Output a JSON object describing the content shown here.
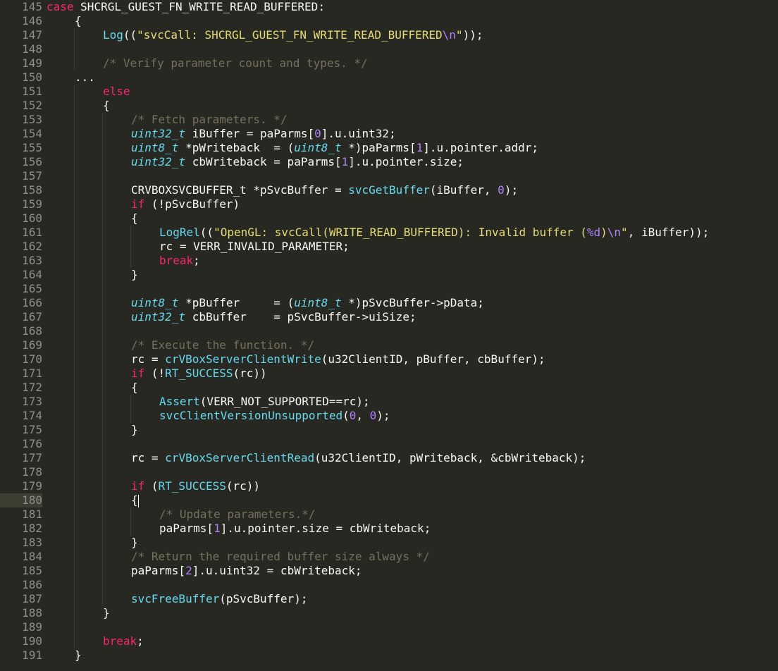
{
  "editor": {
    "theme_colors": {
      "background": "#272822",
      "gutter_text": "#8f908a",
      "keyword": "#f92672",
      "function": "#66d9ef",
      "type": "#66d9ef",
      "number": "#ae81ff",
      "string": "#e6db74",
      "comment": "#75715e",
      "plain": "#f8f8f2",
      "current_line": "#3e3d32"
    },
    "current_line_number": "180",
    "lines": [
      {
        "n": "145",
        "indent": 0,
        "tokens": [
          {
            "t": "kw",
            "v": "case"
          },
          {
            "t": "pl",
            "v": " SHCRGL_GUEST_FN_WRITE_READ_BUFFERED:"
          }
        ]
      },
      {
        "n": "146",
        "indent": 2,
        "tokens": [
          {
            "t": "pl",
            "v": "{"
          }
        ]
      },
      {
        "n": "147",
        "indent": 3,
        "tokens": [
          {
            "t": "fn",
            "v": "Log"
          },
          {
            "t": "pl",
            "v": "(("
          },
          {
            "t": "str",
            "v": "\"svcCall: SHCRGL_GUEST_FN_WRITE_READ_BUFFERED"
          },
          {
            "t": "num",
            "v": "\\n"
          },
          {
            "t": "str",
            "v": "\""
          },
          {
            "t": "pl",
            "v": "));"
          }
        ]
      },
      {
        "n": "148",
        "indent": 3,
        "tokens": []
      },
      {
        "n": "149",
        "indent": 3,
        "tokens": [
          {
            "t": "cmt",
            "v": "/* Verify parameter count and types. */"
          }
        ]
      },
      {
        "n": "150",
        "indent": 2,
        "tokens": [
          {
            "t": "pl",
            "v": "..."
          }
        ]
      },
      {
        "n": "151",
        "indent": 3,
        "tokens": [
          {
            "t": "kw",
            "v": "else"
          }
        ]
      },
      {
        "n": "152",
        "indent": 3,
        "tokens": [
          {
            "t": "pl",
            "v": "{"
          }
        ]
      },
      {
        "n": "153",
        "indent": 4,
        "tokens": [
          {
            "t": "cmt",
            "v": "/* Fetch parameters. */"
          }
        ]
      },
      {
        "n": "154",
        "indent": 4,
        "tokens": [
          {
            "t": "ty",
            "v": "uint32_t"
          },
          {
            "t": "pl",
            "v": " iBuffer = paParms["
          },
          {
            "t": "num",
            "v": "0"
          },
          {
            "t": "pl",
            "v": "].u.uint32;"
          }
        ]
      },
      {
        "n": "155",
        "indent": 4,
        "tokens": [
          {
            "t": "ty",
            "v": "uint8_t"
          },
          {
            "t": "pl",
            "v": " *pWriteback  = ("
          },
          {
            "t": "ty",
            "v": "uint8_t"
          },
          {
            "t": "pl",
            "v": " *)paParms["
          },
          {
            "t": "num",
            "v": "1"
          },
          {
            "t": "pl",
            "v": "].u.pointer.addr;"
          }
        ]
      },
      {
        "n": "156",
        "indent": 4,
        "tokens": [
          {
            "t": "ty",
            "v": "uint32_t"
          },
          {
            "t": "pl",
            "v": " cbWriteback = paParms["
          },
          {
            "t": "num",
            "v": "1"
          },
          {
            "t": "pl",
            "v": "].u.pointer.size;"
          }
        ]
      },
      {
        "n": "157",
        "indent": 4,
        "tokens": []
      },
      {
        "n": "158",
        "indent": 4,
        "tokens": [
          {
            "t": "pl",
            "v": "CRVBOXSVCBUFFER_t *pSvcBuffer = "
          },
          {
            "t": "fn",
            "v": "svcGetBuffer"
          },
          {
            "t": "pl",
            "v": "(iBuffer, "
          },
          {
            "t": "num",
            "v": "0"
          },
          {
            "t": "pl",
            "v": ");"
          }
        ]
      },
      {
        "n": "159",
        "indent": 4,
        "tokens": [
          {
            "t": "kw",
            "v": "if"
          },
          {
            "t": "pl",
            "v": " (!pSvcBuffer)"
          }
        ]
      },
      {
        "n": "160",
        "indent": 4,
        "tokens": [
          {
            "t": "pl",
            "v": "{"
          }
        ]
      },
      {
        "n": "161",
        "indent": 5,
        "tokens": [
          {
            "t": "fn",
            "v": "LogRel"
          },
          {
            "t": "pl",
            "v": "(("
          },
          {
            "t": "str",
            "v": "\"OpenGL: svcCall(WRITE_READ_BUFFERED): Invalid buffer ("
          },
          {
            "t": "num",
            "v": "%d"
          },
          {
            "t": "str",
            "v": ")"
          },
          {
            "t": "num",
            "v": "\\n"
          },
          {
            "t": "str",
            "v": "\""
          },
          {
            "t": "pl",
            "v": ", iBuffer));"
          }
        ]
      },
      {
        "n": "162",
        "indent": 5,
        "tokens": [
          {
            "t": "pl",
            "v": "rc = VERR_INVALID_PARAMETER;"
          }
        ]
      },
      {
        "n": "163",
        "indent": 5,
        "tokens": [
          {
            "t": "kw",
            "v": "break"
          },
          {
            "t": "pl",
            "v": ";"
          }
        ]
      },
      {
        "n": "164",
        "indent": 4,
        "tokens": [
          {
            "t": "pl",
            "v": "}"
          }
        ]
      },
      {
        "n": "165",
        "indent": 4,
        "tokens": []
      },
      {
        "n": "166",
        "indent": 4,
        "tokens": [
          {
            "t": "ty",
            "v": "uint8_t"
          },
          {
            "t": "pl",
            "v": " *pBuffer     = ("
          },
          {
            "t": "ty",
            "v": "uint8_t"
          },
          {
            "t": "pl",
            "v": " *)pSvcBuffer->pData;"
          }
        ]
      },
      {
        "n": "167",
        "indent": 4,
        "tokens": [
          {
            "t": "ty",
            "v": "uint32_t"
          },
          {
            "t": "pl",
            "v": " cbBuffer    = pSvcBuffer->uiSize;"
          }
        ]
      },
      {
        "n": "168",
        "indent": 4,
        "tokens": []
      },
      {
        "n": "169",
        "indent": 4,
        "tokens": [
          {
            "t": "cmt",
            "v": "/* Execute the function. */"
          }
        ]
      },
      {
        "n": "170",
        "indent": 4,
        "tokens": [
          {
            "t": "pl",
            "v": "rc = "
          },
          {
            "t": "fn",
            "v": "crVBoxServerClientWrite"
          },
          {
            "t": "pl",
            "v": "(u32ClientID, pBuffer, cbBuffer);"
          }
        ]
      },
      {
        "n": "171",
        "indent": 4,
        "tokens": [
          {
            "t": "kw",
            "v": "if"
          },
          {
            "t": "pl",
            "v": " (!"
          },
          {
            "t": "fn",
            "v": "RT_SUCCESS"
          },
          {
            "t": "pl",
            "v": "(rc))"
          }
        ]
      },
      {
        "n": "172",
        "indent": 4,
        "tokens": [
          {
            "t": "pl",
            "v": "{"
          }
        ]
      },
      {
        "n": "173",
        "indent": 5,
        "tokens": [
          {
            "t": "fn",
            "v": "Assert"
          },
          {
            "t": "pl",
            "v": "(VERR_NOT_SUPPORTED==rc);"
          }
        ]
      },
      {
        "n": "174",
        "indent": 5,
        "tokens": [
          {
            "t": "fn",
            "v": "svcClientVersionUnsupported"
          },
          {
            "t": "pl",
            "v": "("
          },
          {
            "t": "num",
            "v": "0"
          },
          {
            "t": "pl",
            "v": ", "
          },
          {
            "t": "num",
            "v": "0"
          },
          {
            "t": "pl",
            "v": ");"
          }
        ]
      },
      {
        "n": "175",
        "indent": 4,
        "tokens": [
          {
            "t": "pl",
            "v": "}"
          }
        ]
      },
      {
        "n": "176",
        "indent": 4,
        "tokens": []
      },
      {
        "n": "177",
        "indent": 4,
        "tokens": [
          {
            "t": "pl",
            "v": "rc = "
          },
          {
            "t": "fn",
            "v": "crVBoxServerClientRead"
          },
          {
            "t": "pl",
            "v": "(u32ClientID, pWriteback, &cbWriteback);"
          }
        ]
      },
      {
        "n": "178",
        "indent": 4,
        "tokens": []
      },
      {
        "n": "179",
        "indent": 4,
        "tokens": [
          {
            "t": "kw",
            "v": "if"
          },
          {
            "t": "pl",
            "v": " ("
          },
          {
            "t": "fn",
            "v": "RT_SUCCESS"
          },
          {
            "t": "pl",
            "v": "(rc))"
          }
        ]
      },
      {
        "n": "180",
        "indent": 4,
        "tokens": [
          {
            "t": "pl",
            "v": "{"
          },
          {
            "t": "cursor",
            "v": ""
          }
        ]
      },
      {
        "n": "181",
        "indent": 5,
        "tokens": [
          {
            "t": "cmt",
            "v": "/* Update parameters.*/"
          }
        ]
      },
      {
        "n": "182",
        "indent": 5,
        "tokens": [
          {
            "t": "pl",
            "v": "paParms["
          },
          {
            "t": "num",
            "v": "1"
          },
          {
            "t": "pl",
            "v": "].u.pointer.size = cbWriteback;"
          }
        ]
      },
      {
        "n": "183",
        "indent": 4,
        "tokens": [
          {
            "t": "pl",
            "v": "}"
          }
        ]
      },
      {
        "n": "184",
        "indent": 4,
        "tokens": [
          {
            "t": "cmt",
            "v": "/* Return the required buffer size always */"
          }
        ]
      },
      {
        "n": "185",
        "indent": 4,
        "tokens": [
          {
            "t": "pl",
            "v": "paParms["
          },
          {
            "t": "num",
            "v": "2"
          },
          {
            "t": "pl",
            "v": "].u.uint32 = cbWriteback;"
          }
        ]
      },
      {
        "n": "186",
        "indent": 4,
        "tokens": []
      },
      {
        "n": "187",
        "indent": 4,
        "tokens": [
          {
            "t": "fn",
            "v": "svcFreeBuffer"
          },
          {
            "t": "pl",
            "v": "(pSvcBuffer);"
          }
        ]
      },
      {
        "n": "188",
        "indent": 3,
        "tokens": [
          {
            "t": "pl",
            "v": "}"
          }
        ]
      },
      {
        "n": "189",
        "indent": 3,
        "tokens": []
      },
      {
        "n": "190",
        "indent": 3,
        "tokens": [
          {
            "t": "kw",
            "v": "break"
          },
          {
            "t": "pl",
            "v": ";"
          }
        ]
      },
      {
        "n": "191",
        "indent": 2,
        "tokens": [
          {
            "t": "pl",
            "v": "}"
          }
        ]
      }
    ]
  }
}
